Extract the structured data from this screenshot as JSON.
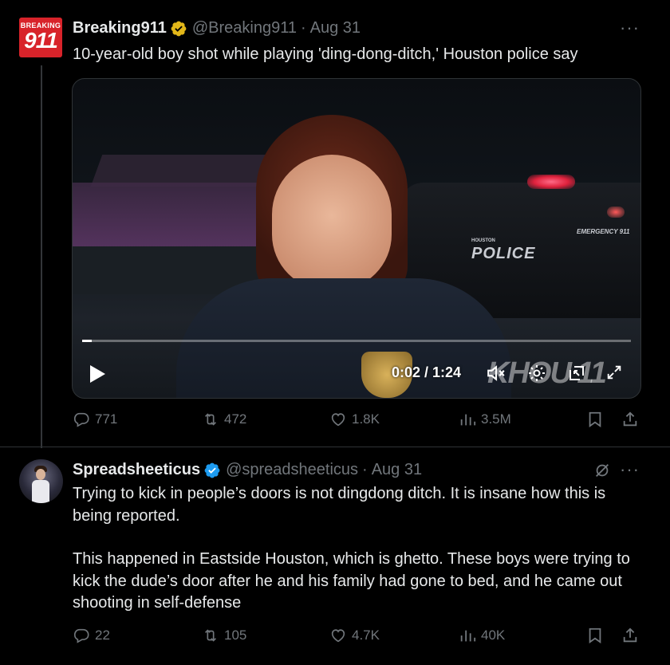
{
  "tweets": [
    {
      "avatar": {
        "top_text": "BREAKING",
        "number": "911"
      },
      "name": "Breaking911",
      "verified": "gold-check-icon",
      "handle": "@Breaking911",
      "separator": "·",
      "date": "Aug 31",
      "more": "···",
      "text": [
        "10-year-old boy shot while playing 'ding-dong-ditch,' Houston police say"
      ],
      "media": {
        "time": "0:02 / 1:24",
        "watermark": "KHOU 11",
        "car_label": "POLICE",
        "car_sublabel": "HOUSTON",
        "car_emergency": "EMERGENCY 911",
        "progress_fraction": 0.017
      },
      "stats": {
        "replies": "771",
        "reposts": "472",
        "likes": "1.8K",
        "views": "3.5M"
      }
    },
    {
      "name": "Spreadsheeticus",
      "verified": "blue-check-icon",
      "handle": "@spreadsheeticus",
      "separator": "·",
      "date": "Aug 31",
      "more": "···",
      "text": [
        "Trying to kick in people’s doors is not dingdong ditch. It is insane how this is being reported.",
        "This happened in Eastside Houston, which is ghetto. These boys were trying to kick the dude’s door after he and his family had gone to bed, and he came out shooting in self-defense"
      ],
      "stats": {
        "replies": "22",
        "reposts": "105",
        "likes": "4.7K",
        "views": "40K"
      }
    }
  ],
  "colors": {
    "background": "#000000",
    "text": "#e7e9ea",
    "muted": "#71767b",
    "gold": "#e2b719",
    "blue": "#1d9bf0"
  }
}
